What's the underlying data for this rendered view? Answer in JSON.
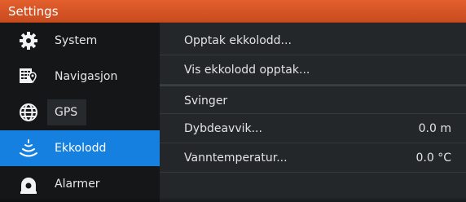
{
  "window": {
    "title": "Settings",
    "accent_color": "#e45f2d",
    "selection_color": "#1680e0"
  },
  "sidebar": {
    "items": [
      {
        "label": "System",
        "icon": "gear-icon",
        "selected": false
      },
      {
        "label": "Navigasjon",
        "icon": "navigation-icon",
        "selected": false
      },
      {
        "label": "GPS",
        "icon": "globe-icon",
        "selected": false
      },
      {
        "label": "Ekkolodd",
        "icon": "sonar-icon",
        "selected": true
      },
      {
        "label": "Alarmer",
        "icon": "alarm-icon",
        "selected": false
      }
    ]
  },
  "content": {
    "rows": [
      {
        "label": "Opptak ekkolodd..."
      },
      {
        "label": "Vis ekkolodd opptak..."
      },
      {
        "label": "Svinger"
      },
      {
        "label": "Dybdeavvik...",
        "value": "0.0 m"
      },
      {
        "label": "Vanntemperatur...",
        "value": "0.0 °C"
      }
    ]
  }
}
